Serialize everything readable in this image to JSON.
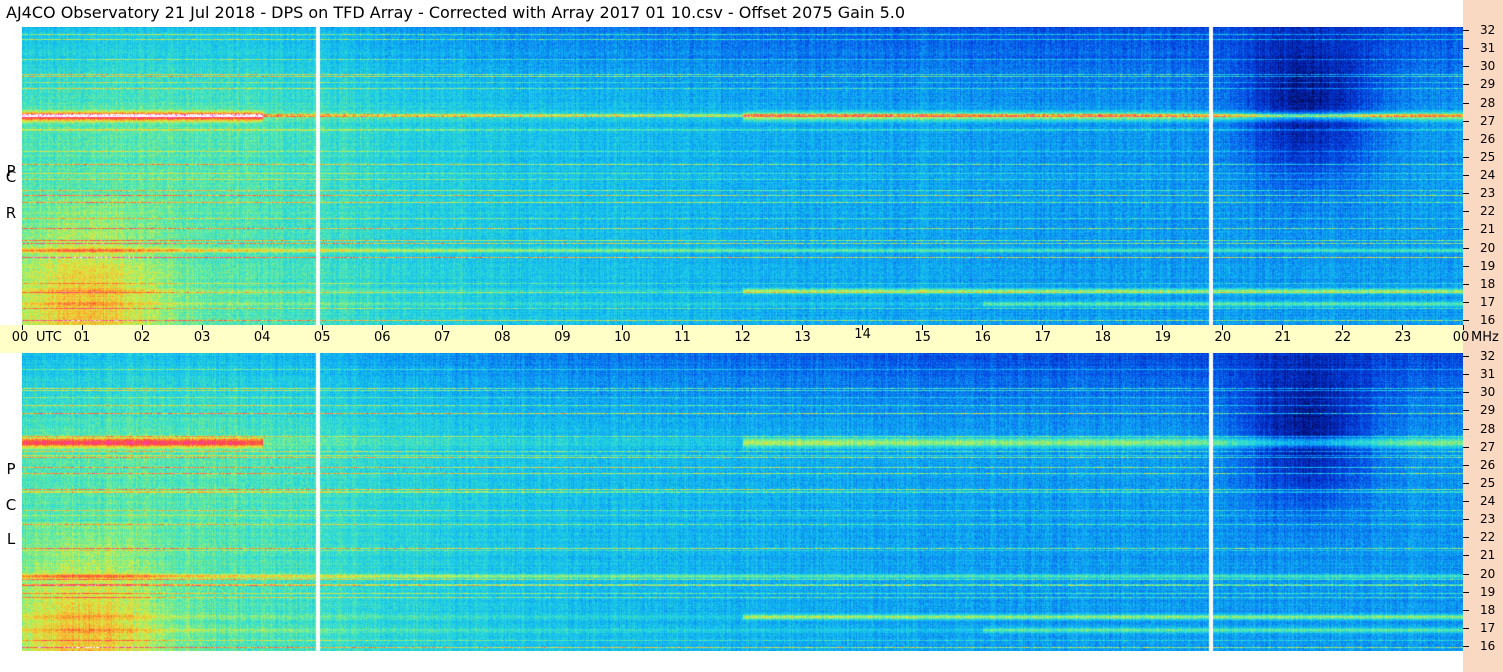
{
  "title": "AJ4CO Observatory  21 Jul 2018  -  DPS on TFD Array  -  Corrected with Array 2017 01 10.csv  -  Offset 2075  Gain 5.0",
  "chart_data": {
    "type": "heatmap",
    "panels": [
      {
        "name": "RCP",
        "letters": [
          "R",
          "C",
          "P"
        ]
      },
      {
        "name": "LCP",
        "letters": [
          "L",
          "C",
          "P"
        ]
      }
    ],
    "x_axis": {
      "unit": "UTC",
      "ticks": [
        "00",
        "01",
        "02",
        "03",
        "04",
        "05",
        "06",
        "07",
        "08",
        "09",
        "10",
        "11",
        "12",
        "13",
        "14",
        "15",
        "16",
        "17",
        "18",
        "19",
        "20",
        "21",
        "22",
        "23",
        "00"
      ],
      "range_hours": [
        0,
        24
      ]
    },
    "y_axis": {
      "unit": "MHz",
      "ticks": [
        "32",
        "31",
        "30",
        "29",
        "28",
        "27",
        "26",
        "25",
        "24",
        "23",
        "22",
        "21",
        "20",
        "19",
        "18",
        "17",
        "16"
      ],
      "range_mhz": [
        16,
        32
      ]
    },
    "features": {
      "white_gaps_utc": [
        4.93,
        19.8
      ],
      "strong_bands_mhz": [
        27.2,
        17.8,
        17.1,
        20.0
      ],
      "intense_region": {
        "utc": [
          0,
          2.5
        ],
        "mhz": [
          16,
          23
        ]
      },
      "dark_region": {
        "utc": [
          20.5,
          22.5
        ],
        "mhz": [
          23,
          30
        ]
      }
    },
    "palette": [
      "#00002a",
      "#001a9a",
      "#0040e0",
      "#0a7ef0",
      "#10b6f2",
      "#2ad8d8",
      "#6aec9a",
      "#d8ee42",
      "#ffa82e",
      "#ff4a3a",
      "#ff3ab8",
      "#ffffff"
    ]
  }
}
